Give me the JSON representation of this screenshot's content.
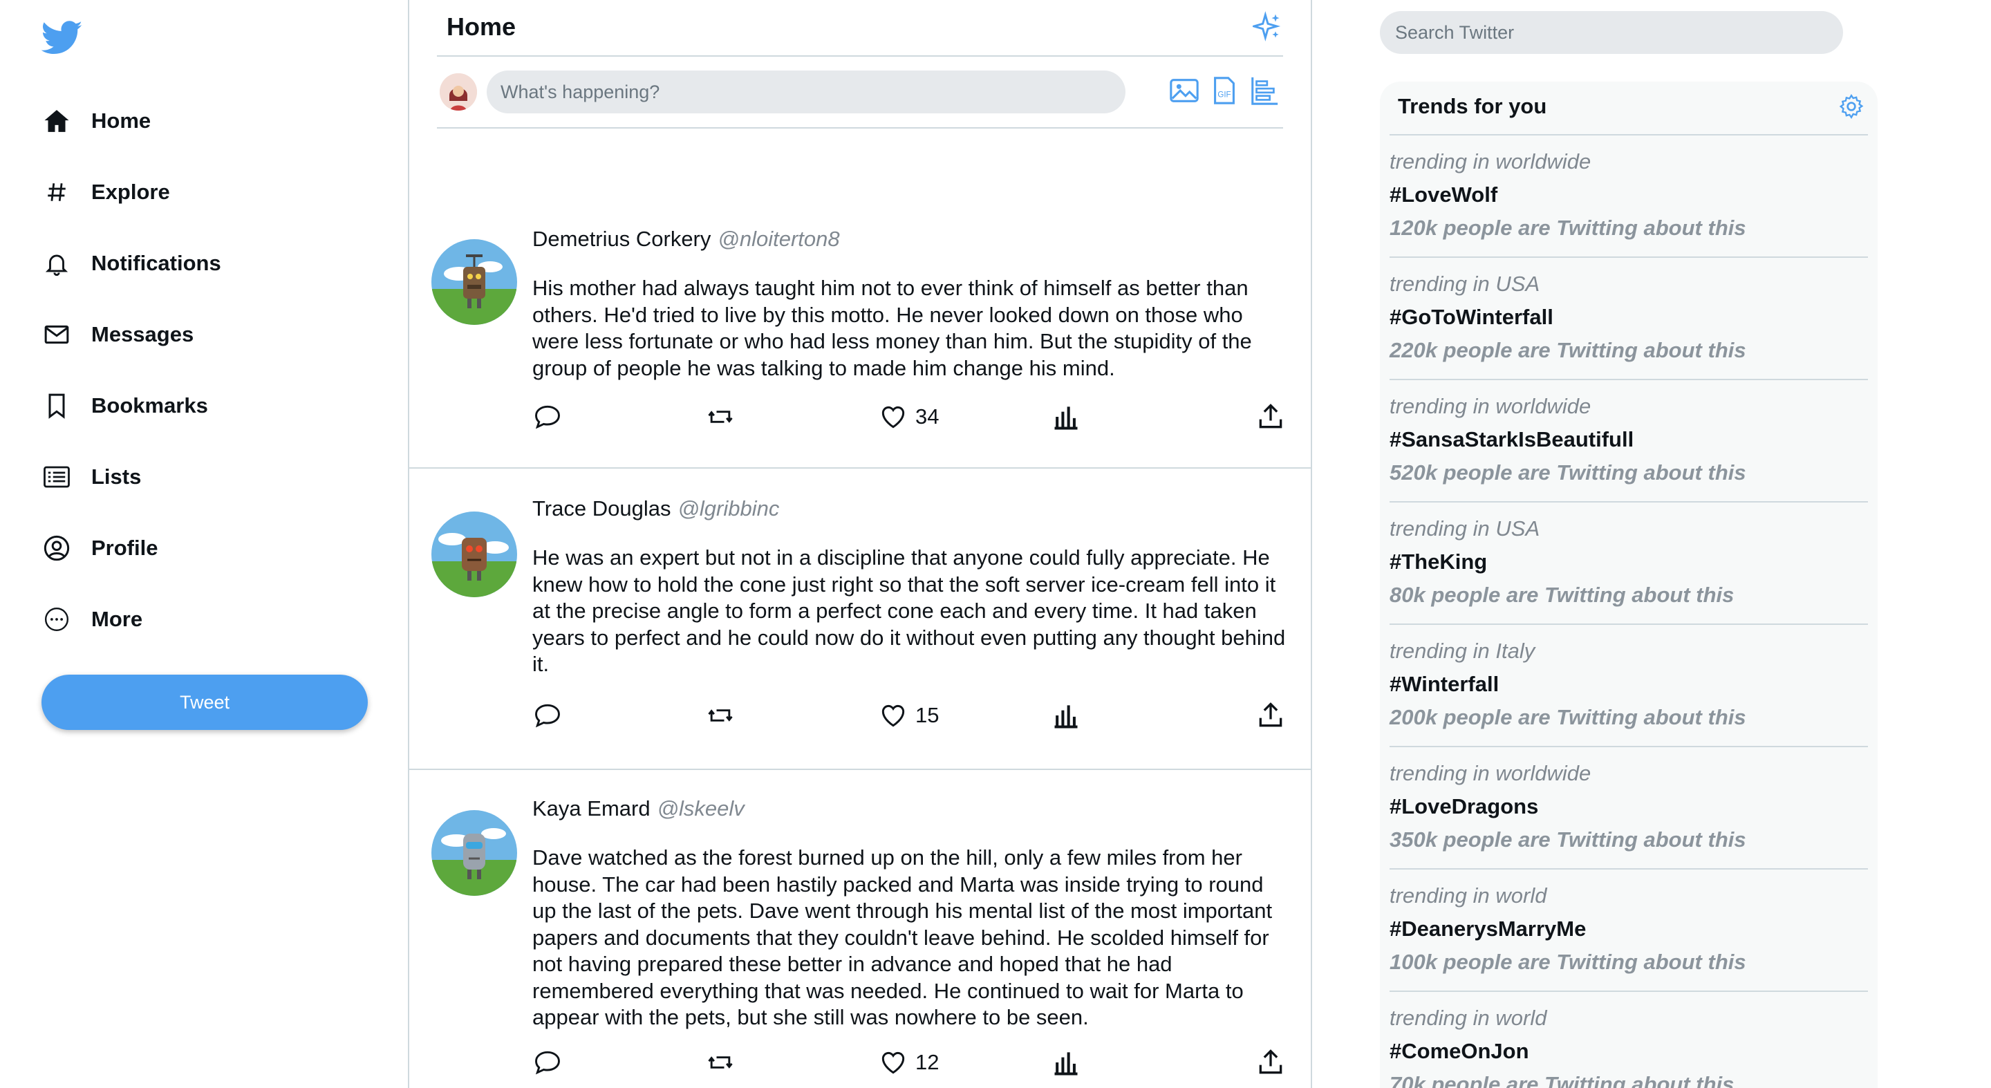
{
  "nav": {
    "items": [
      {
        "label": "Home",
        "icon": "home-icon"
      },
      {
        "label": "Explore",
        "icon": "hashtag-icon"
      },
      {
        "label": "Notifications",
        "icon": "bell-icon"
      },
      {
        "label": "Messages",
        "icon": "envelope-icon"
      },
      {
        "label": "Bookmarks",
        "icon": "bookmark-icon"
      },
      {
        "label": "Lists",
        "icon": "list-icon"
      },
      {
        "label": "Profile",
        "icon": "user-icon"
      },
      {
        "label": "More",
        "icon": "more-icon"
      }
    ],
    "tweet_button": "Tweet"
  },
  "feed": {
    "title": "Home",
    "composer_placeholder": "What's happening?",
    "tweets": [
      {
        "name": "Demetrius Corkery",
        "handle": "@nloiterton8",
        "text": "His mother had always taught him not to ever think of himself as better than others. He'd tried to live by this motto. He never looked down on those who were less fortunate or who had less money than him. But the stupidity of the group of people he was talking to made him change his mind.",
        "likes": "34"
      },
      {
        "name": "Trace Douglas",
        "handle": "@lgribbinc",
        "text": "He was an expert but not in a discipline that anyone could fully appreciate. He knew how to hold the cone just right so that the soft server ice-cream fell into it at the precise angle to form a perfect cone each and every time. It had taken years to perfect and he could now do it without even putting any thought behind it.",
        "likes": "15"
      },
      {
        "name": "Kaya Emard",
        "handle": "@lskeelv",
        "text": "Dave watched as the forest burned up on the hill, only a few miles from her house. The car had been hastily packed and Marta was inside trying to round up the last of the pets. Dave went through his mental list of the most important papers and documents that they couldn't leave behind. He scolded himself for not having prepared these better in advance and hoped that he had remembered everything that was needed. He continued to wait for Marta to appear with the pets, but she still was nowhere to be seen.",
        "likes": "12"
      }
    ]
  },
  "right": {
    "search_placeholder": "Search Twitter",
    "trends_title": "Trends for you",
    "trends": [
      {
        "location": "trending in worldwide",
        "tag": "#LoveWolf",
        "count": "120k people are Twitting about this"
      },
      {
        "location": "trending in USA",
        "tag": "#GoToWinterfall",
        "count": "220k people are Twitting about this"
      },
      {
        "location": "trending in worldwide",
        "tag": "#SansaStarkIsBeautifull",
        "count": "520k people are Twitting about this"
      },
      {
        "location": "trending in USA",
        "tag": "#TheKing",
        "count": "80k people are Twitting about this"
      },
      {
        "location": "trending in Italy",
        "tag": "#Winterfall",
        "count": "200k people are Twitting about this"
      },
      {
        "location": "trending in worldwide",
        "tag": "#LoveDragons",
        "count": "350k people are Twitting about this"
      },
      {
        "location": "trending in world",
        "tag": "#DeanerysMarryMe",
        "count": "100k people are Twitting about this"
      },
      {
        "location": "trending in world",
        "tag": "#ComeOnJon",
        "count": "70k people are Twitting about this"
      }
    ]
  },
  "colors": {
    "accent": "#4d9ff0",
    "border": "#cfd9de",
    "muted": "#808890"
  }
}
